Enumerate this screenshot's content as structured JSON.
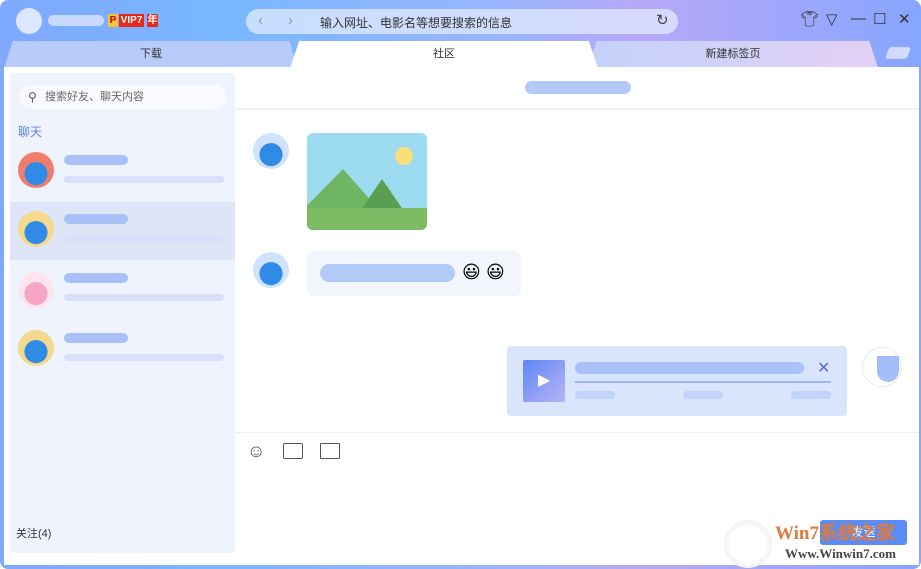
{
  "titlebar": {
    "badge_p": "P",
    "badge_vip": "VIP7",
    "badge_year": "年",
    "address_placeholder": "输入网址、电影名等想要搜索的信息"
  },
  "tabs": [
    {
      "label": "下载"
    },
    {
      "label": "社区"
    },
    {
      "label": "新建标签页"
    }
  ],
  "sidebar": {
    "search_placeholder": "搜索好友、聊天内容",
    "section_label": "聊天",
    "footer_label": "关注(4)"
  },
  "input": {
    "send_label": "发送"
  },
  "watermark": {
    "text": "Win7系统之家",
    "url": "Www.Winwin7.com"
  }
}
